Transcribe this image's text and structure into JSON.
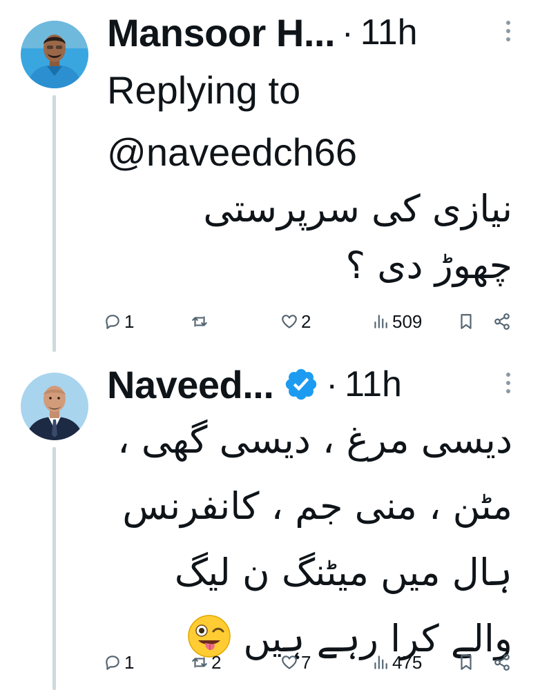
{
  "tweets": [
    {
      "author": "Mansoor H...",
      "separator": "·",
      "time": "11h",
      "verified": false,
      "reply_context": "Replying to @naveedch66",
      "text": "نیازی کی سرپرستی\nچھوڑ دی ؟",
      "has_emoji": false,
      "replies": "1",
      "retweets": "",
      "likes": "2",
      "views": "509",
      "avatar_colors": {
        "background": "#3aa6e0",
        "shirt": "#2b8fd0"
      }
    },
    {
      "author": "Naveed...",
      "separator": "·",
      "time": "11h",
      "verified": true,
      "verified_color": "#1d9bf0",
      "text": "دیسی مرغ ، دیسی گھی ،\nمٹن ، منی جم ، کانفرنس\nہال میں میٹنگ ن لیگ\nوالے کرا رہے ہیں",
      "has_emoji": true,
      "emoji": "winking-face-with-tongue",
      "replies": "1",
      "retweets": "2",
      "likes": "7",
      "views": "475",
      "avatar_colors": {
        "background": "#a8d4ee",
        "suit": "#1c2a44"
      }
    }
  ],
  "colors": {
    "text": "#0f1419",
    "icon": "#536471",
    "thread_line": "#cfd9de",
    "accent": "#1d9bf0"
  }
}
